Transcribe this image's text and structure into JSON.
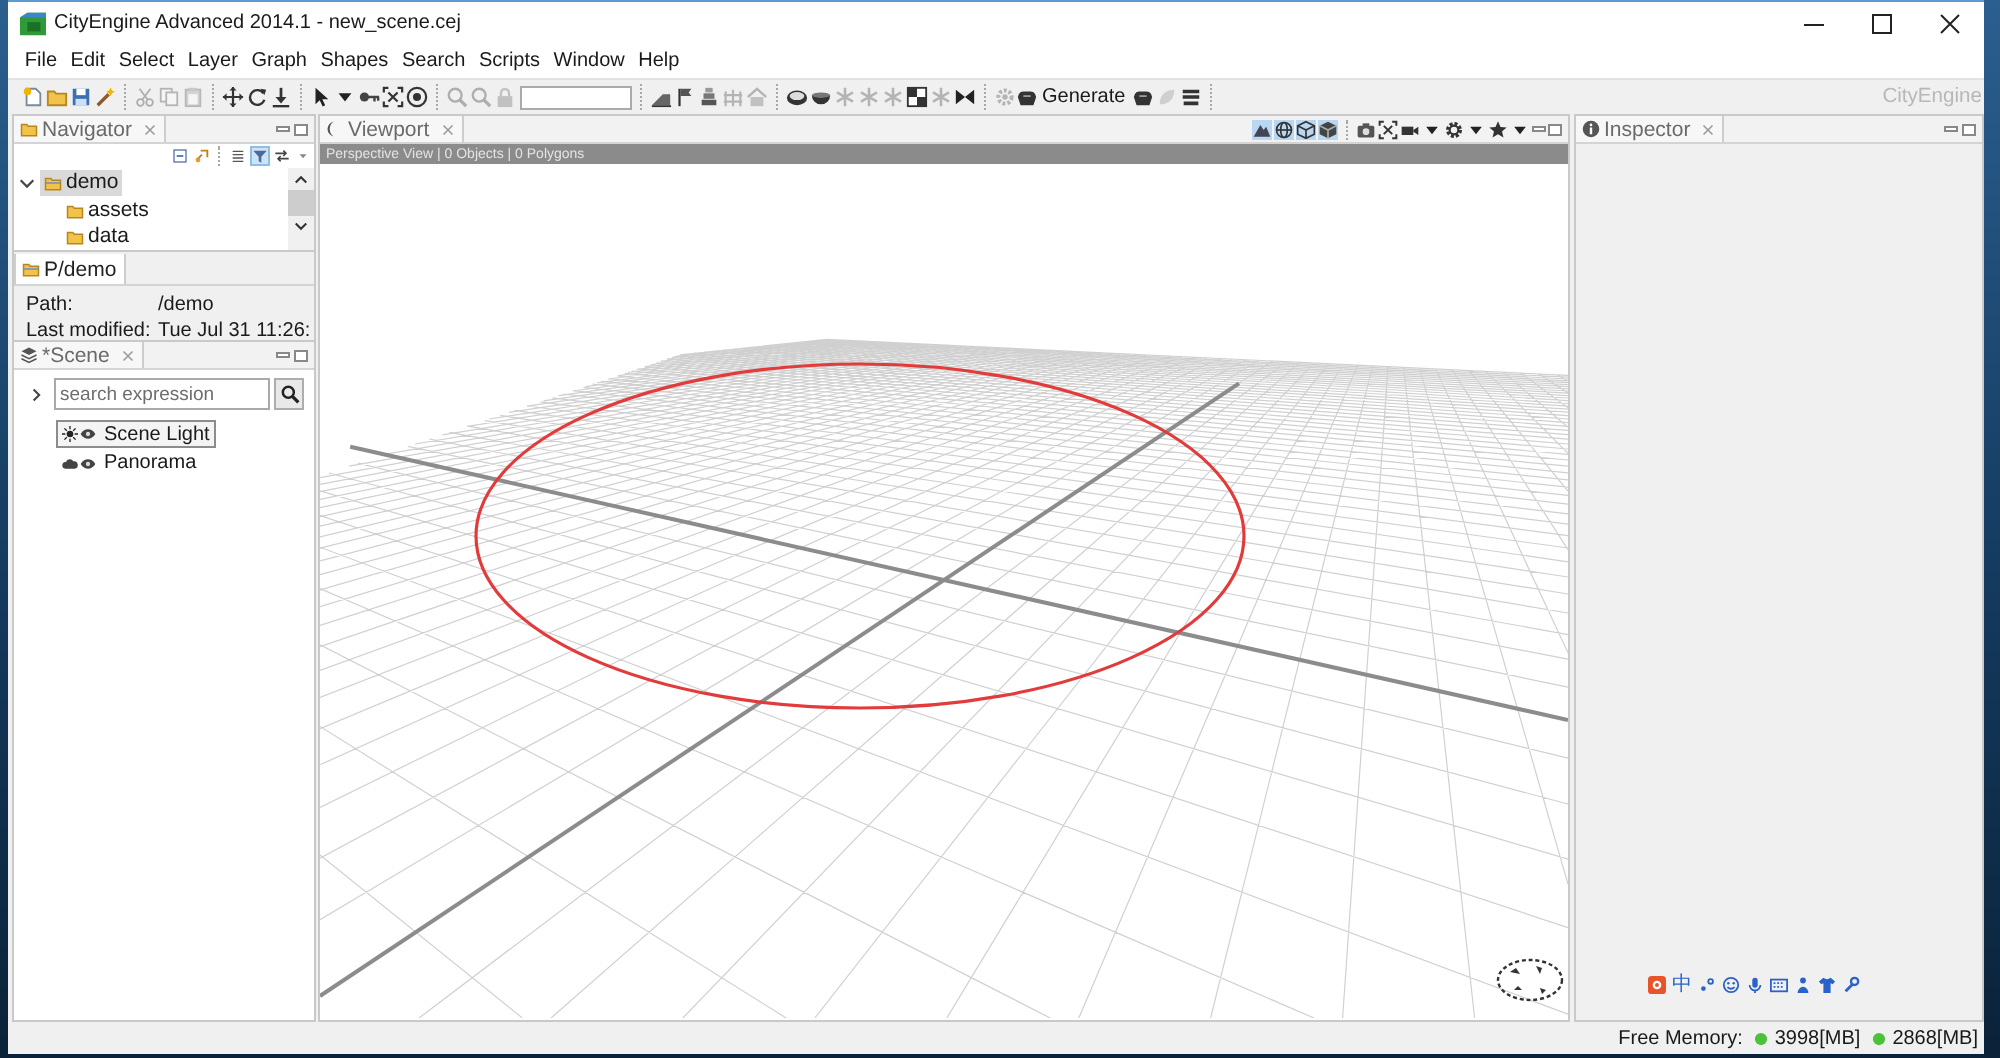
{
  "window": {
    "title": "CityEngine Advanced 2014.1 - new_scene.cej"
  },
  "menu": [
    "File",
    "Edit",
    "Select",
    "Layer",
    "Graph",
    "Shapes",
    "Search",
    "Scripts",
    "Window",
    "Help"
  ],
  "toolbar": {
    "groups": [
      {
        "items": [
          {
            "kind": "tool",
            "disabled": false
          },
          {
            "kind": "tool",
            "disabled": false
          },
          {
            "kind": "tool",
            "disabled": false
          },
          {
            "kind": "tool",
            "disabled": false
          }
        ]
      },
      {
        "items": [
          {
            "kind": "tool",
            "disabled": true
          },
          {
            "kind": "tool",
            "disabled": true
          },
          {
            "kind": "tool",
            "disabled": true
          }
        ]
      },
      {
        "items": [
          {
            "kind": "tool",
            "disabled": false
          },
          {
            "kind": "tool",
            "disabled": false
          },
          {
            "kind": "tool",
            "disabled": false
          }
        ]
      },
      {
        "items": [
          {
            "kind": "tool",
            "disabled": false
          },
          {
            "kind": "tool",
            "disabled": false
          },
          {
            "kind": "tool",
            "disabled": false
          },
          {
            "kind": "tool",
            "disabled": false
          },
          {
            "kind": "tool",
            "disabled": false
          }
        ]
      },
      {
        "items": [
          {
            "kind": "tool",
            "disabled": true
          },
          {
            "kind": "tool",
            "disabled": true
          },
          {
            "kind": "tool",
            "disabled": true
          },
          {
            "kind": "field"
          }
        ]
      },
      {
        "items": [
          {
            "kind": "tool",
            "disabled": false
          },
          {
            "kind": "tool",
            "disabled": false
          },
          {
            "kind": "tool",
            "disabled": false
          },
          {
            "kind": "tool",
            "disabled": true
          },
          {
            "kind": "tool",
            "disabled": true
          }
        ]
      },
      {
        "items": [
          {
            "kind": "tool",
            "disabled": false
          },
          {
            "kind": "tool",
            "disabled": false
          },
          {
            "kind": "tool",
            "disabled": true
          },
          {
            "kind": "tool",
            "disabled": true
          },
          {
            "kind": "tool",
            "disabled": true
          },
          {
            "kind": "tool",
            "disabled": false
          },
          {
            "kind": "tool",
            "disabled": true
          },
          {
            "kind": "tool",
            "disabled": false
          }
        ]
      },
      {
        "items": [
          {
            "kind": "tool",
            "disabled": true
          },
          {
            "kind": "button",
            "disabled": false,
            "label": "Generate"
          },
          {
            "kind": "tool",
            "disabled": false
          },
          {
            "kind": "tool",
            "disabled": true
          },
          {
            "kind": "tool",
            "disabled": false
          }
        ]
      }
    ],
    "brand": "CityEngine"
  },
  "navigator": {
    "title": "Navigator",
    "tools": [
      {
        "on": false
      },
      {
        "on": false
      },
      {
        "on": false
      },
      {
        "on": true
      },
      {
        "on": false
      }
    ],
    "tree": [
      {
        "label": "demo",
        "expanded": true,
        "selected": true,
        "children": [
          {
            "label": "assets",
            "selected": false
          },
          {
            "label": "data",
            "selected": false
          }
        ]
      }
    ]
  },
  "properties": {
    "tab": "P/demo",
    "rows": [
      {
        "key": "Path:",
        "value": "/demo"
      },
      {
        "key": "Last modified:",
        "value": "Tue Jul 31 11:26:"
      }
    ]
  },
  "scene": {
    "title": "*Scene",
    "search": {
      "placeholder": "search expression"
    },
    "layers": [
      {
        "kind": "light",
        "label": "Scene Light",
        "selected": true
      },
      {
        "kind": "panorama",
        "label": "Panorama",
        "selected": false
      }
    ]
  },
  "viewport": {
    "title": "Viewport",
    "info": "Perspective View | 0 Objects | 0 Polygons",
    "view_modes": [
      {
        "on": true
      },
      {
        "on": true
      },
      {
        "on": true
      },
      {
        "on": true
      }
    ]
  },
  "inspector": {
    "title": "Inspector"
  },
  "ime": {
    "mode": "中"
  },
  "status_bar": {
    "label": "Free Memory:",
    "readings": [
      "3998[MB]",
      "2868[MB]"
    ]
  }
}
